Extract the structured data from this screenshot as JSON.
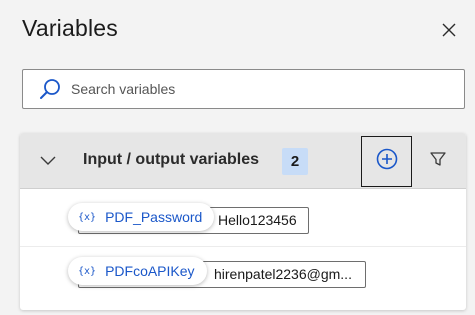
{
  "panel": {
    "title": "Variables",
    "close_icon": "close-icon"
  },
  "search": {
    "placeholder": "Search variables",
    "value": "",
    "icon": "search-icon"
  },
  "section": {
    "title": "Input / output variables",
    "count": "2",
    "collapse_icon": "chevron-down-icon",
    "add_icon": "add-circle-icon",
    "filter_icon": "filter-icon",
    "variables": [
      {
        "name": "PDF_Password",
        "type_glyph": "{x}",
        "value": "Hello123456"
      },
      {
        "name": "PDFcoAPIKey",
        "type_glyph": "{x}",
        "value": "hirenpatel2236@gm..."
      }
    ]
  },
  "colors": {
    "background": "#f3f3f3",
    "header_bg": "#e6e6e6",
    "badge_bg": "#c7dcf7",
    "accent": "#1a57c9"
  }
}
